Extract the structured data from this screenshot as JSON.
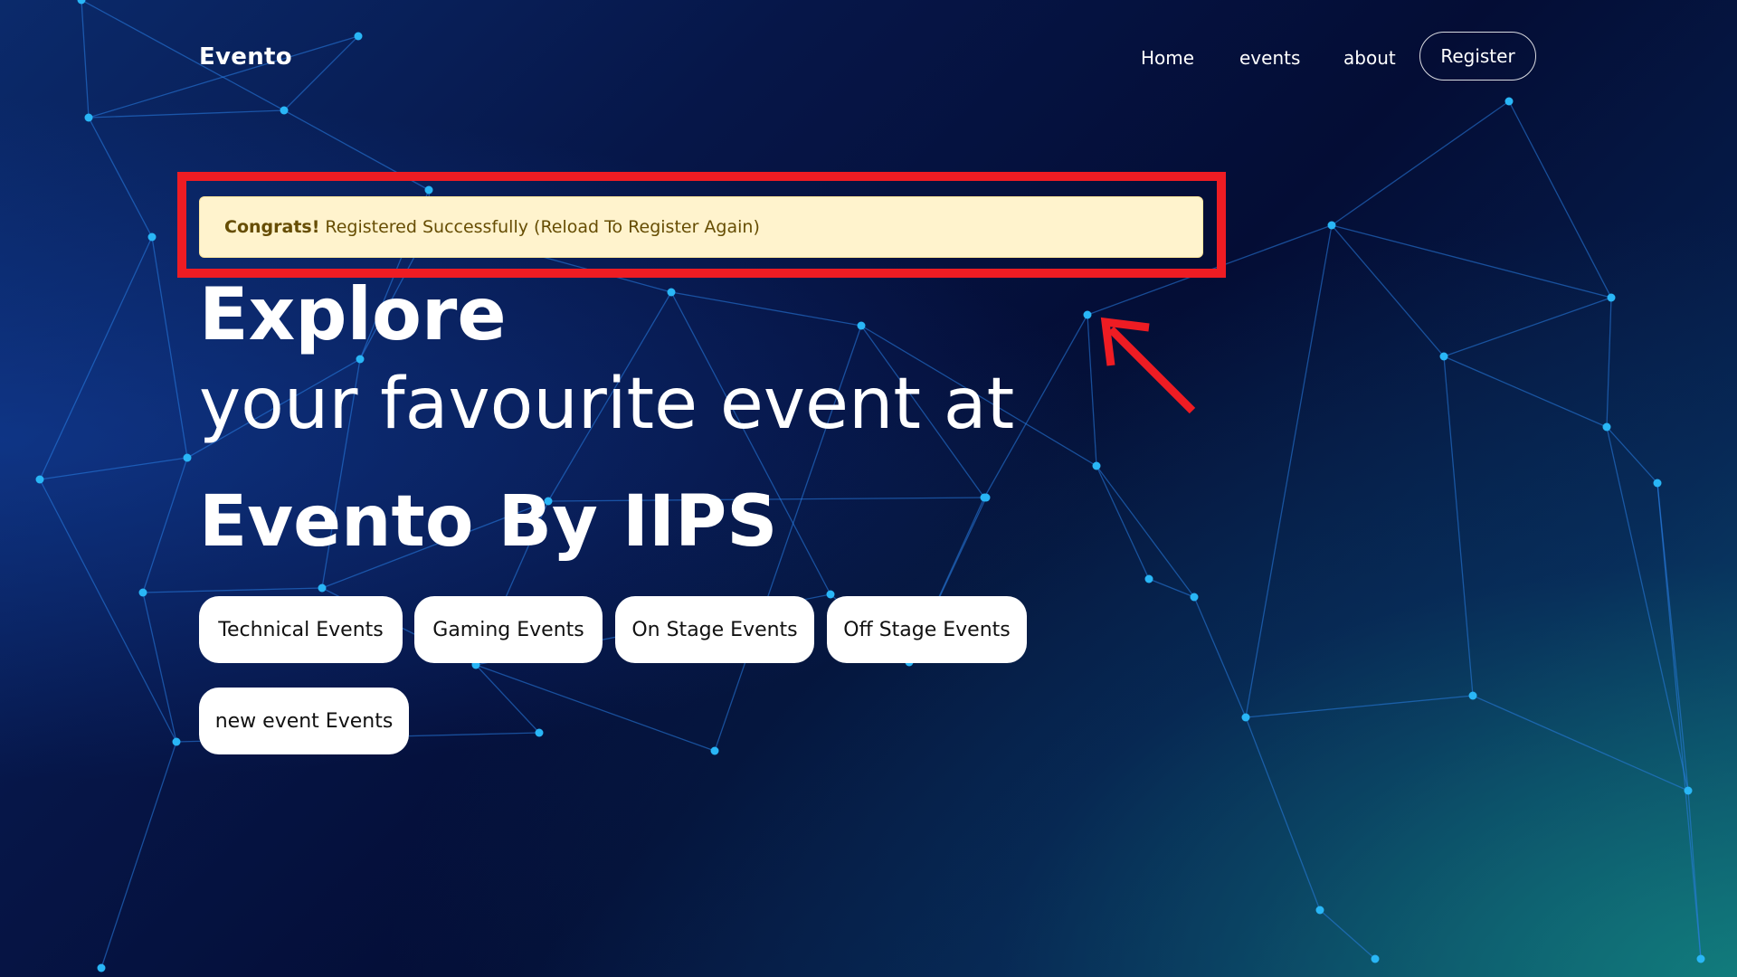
{
  "colors": {
    "background": "#061648",
    "alert_background": "#fff3cd",
    "alert_text": "#664d03",
    "highlight_annotation": "#ee1c23",
    "node_dot": "#29b6f6"
  },
  "nav": {
    "brand": "Evento",
    "links": [
      {
        "label": "Home"
      },
      {
        "label": "events"
      },
      {
        "label": "about"
      }
    ],
    "register_label": "Register"
  },
  "alert": {
    "strong_text": "Congrats!",
    "message": "Registered Successfully (Reload To Register Again)"
  },
  "hero": {
    "title_line1": "Explore",
    "subtitle": "your favourite event at",
    "title_line2": "Evento By IIPS"
  },
  "categories": [
    {
      "label": "Technical Events"
    },
    {
      "label": "Gaming Events"
    },
    {
      "label": "On Stage Events"
    },
    {
      "label": "Off Stage Events"
    },
    {
      "label": "new event Events"
    }
  ],
  "icons": {
    "annotation_arrow": "arrow-up-left-icon"
  }
}
